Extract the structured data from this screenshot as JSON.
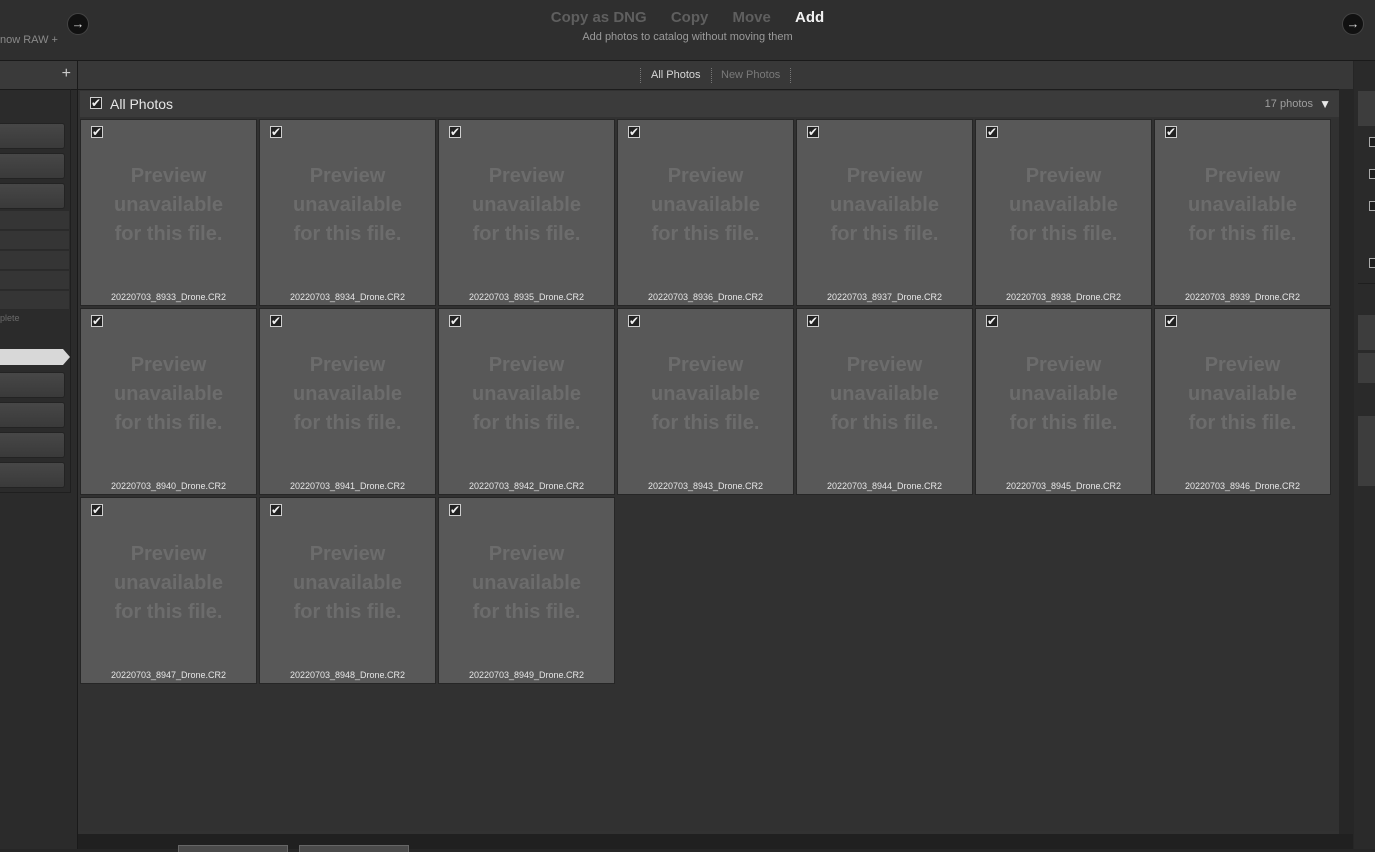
{
  "top": {
    "left_text": "now RAW +",
    "modes": [
      "Copy as DNG",
      "Copy",
      "Move",
      "Add"
    ],
    "active_mode": "Add",
    "mode_description": "Add photos to catalog without moving them"
  },
  "left_panel": {
    "partial_text": "plete"
  },
  "tabs": {
    "all_photos": "All Photos",
    "new_photos": "New Photos"
  },
  "section": {
    "title": "All Photos",
    "count": "17 photos",
    "checked": true
  },
  "preview_text": "Preview\nunavailable\nfor this file.",
  "photos": [
    {
      "name": "20220703_8933_Drone.CR2",
      "checked": true
    },
    {
      "name": "20220703_8934_Drone.CR2",
      "checked": true
    },
    {
      "name": "20220703_8935_Drone.CR2",
      "checked": true
    },
    {
      "name": "20220703_8936_Drone.CR2",
      "checked": true
    },
    {
      "name": "20220703_8937_Drone.CR2",
      "checked": true
    },
    {
      "name": "20220703_8938_Drone.CR2",
      "checked": true
    },
    {
      "name": "20220703_8939_Drone.CR2",
      "checked": true
    },
    {
      "name": "20220703_8940_Drone.CR2",
      "checked": true
    },
    {
      "name": "20220703_8941_Drone.CR2",
      "checked": true
    },
    {
      "name": "20220703_8942_Drone.CR2",
      "checked": true
    },
    {
      "name": "20220703_8943_Drone.CR2",
      "checked": true
    },
    {
      "name": "20220703_8944_Drone.CR2",
      "checked": true
    },
    {
      "name": "20220703_8945_Drone.CR2",
      "checked": true
    },
    {
      "name": "20220703_8946_Drone.CR2",
      "checked": true
    },
    {
      "name": "20220703_8947_Drone.CR2",
      "checked": true
    },
    {
      "name": "20220703_8948_Drone.CR2",
      "checked": true
    },
    {
      "name": "20220703_8949_Drone.CR2",
      "checked": true
    }
  ],
  "icons": {
    "arrow": "→",
    "check": "✔",
    "plus": "+",
    "collapse": "▼"
  }
}
